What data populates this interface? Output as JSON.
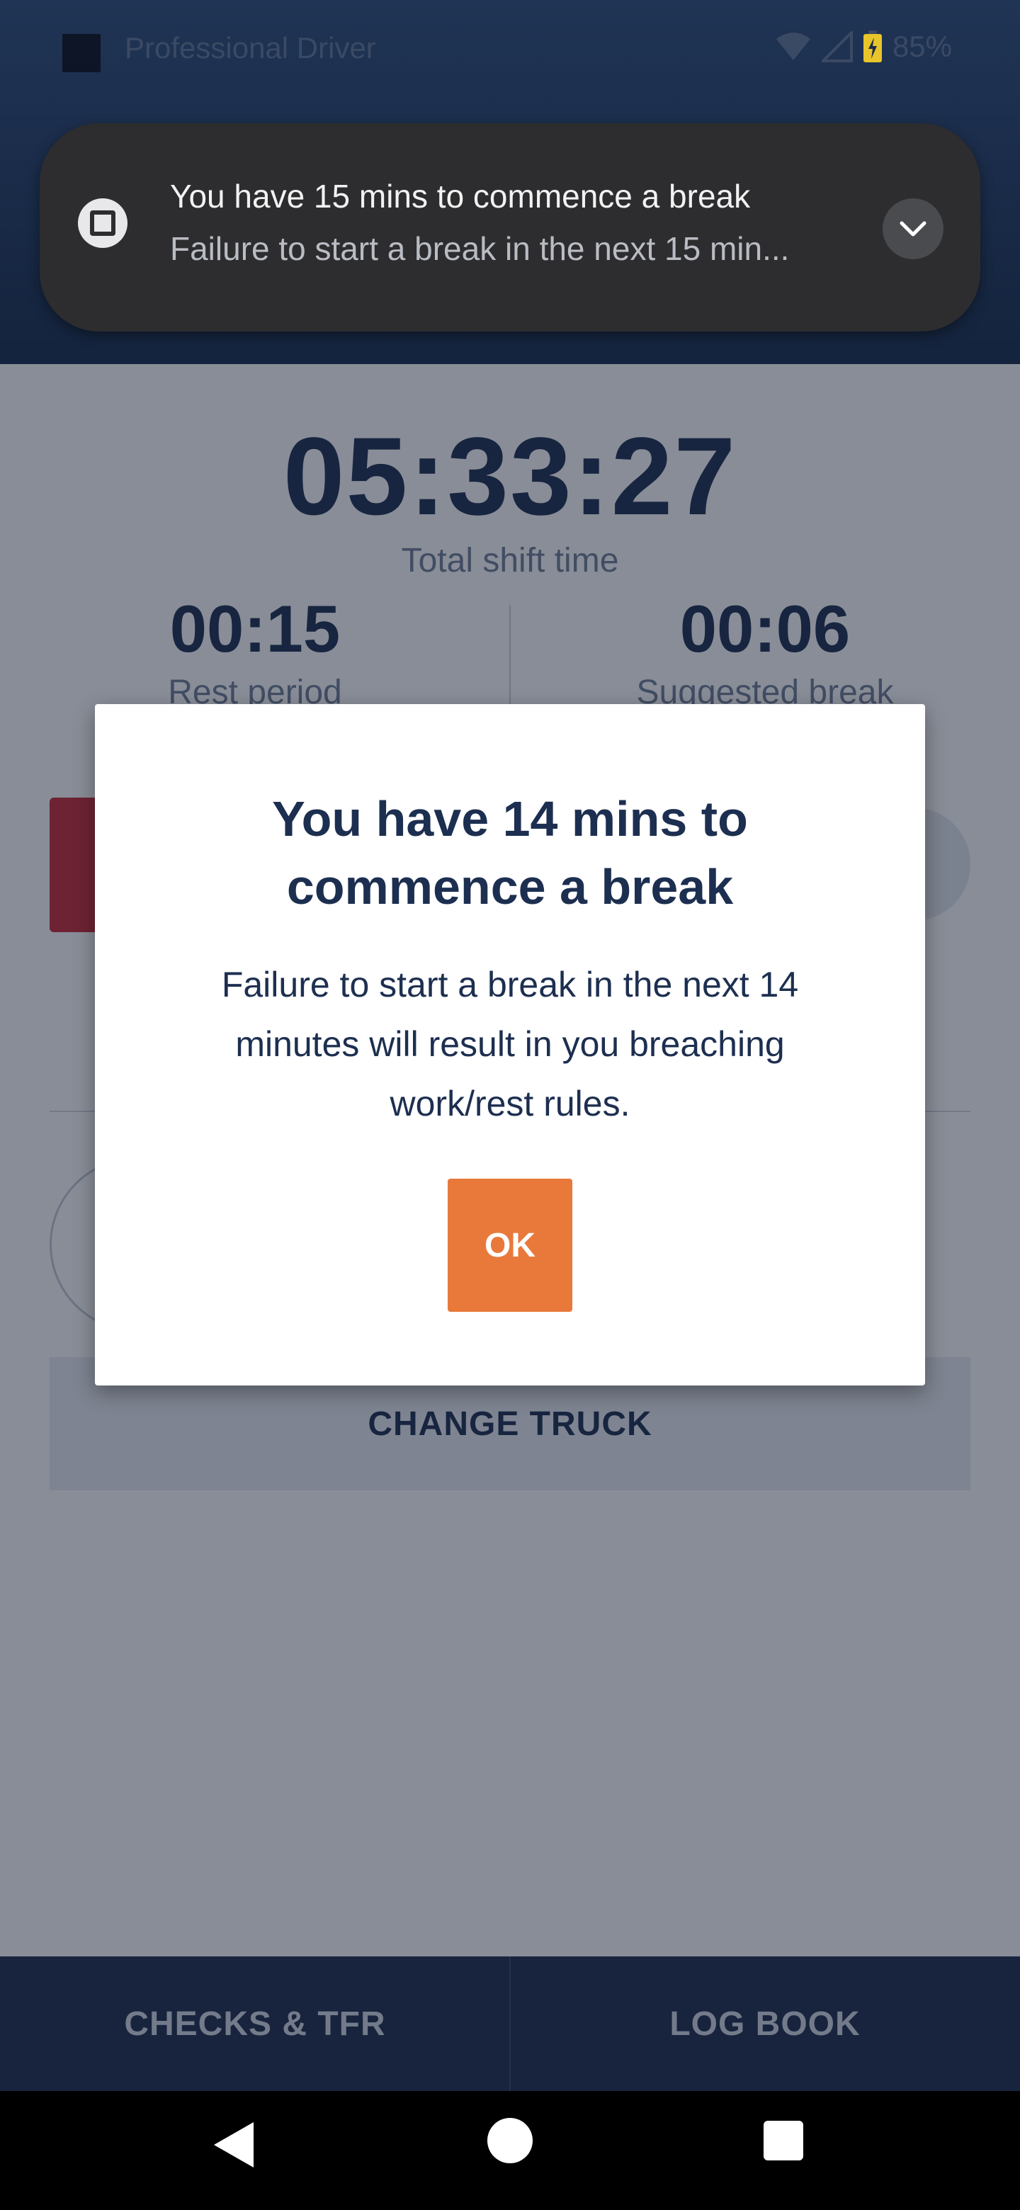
{
  "status_bar": {
    "app_name": "Professional Driver",
    "battery": "85%"
  },
  "notification": {
    "title": "You have 15 mins to commence a break",
    "text": "Failure to start a break in the next 15 min..."
  },
  "shift": {
    "total_time": "05:33:27",
    "total_label": "Total shift time",
    "rest_value": "00:15",
    "rest_label": "Rest period",
    "suggested_value": "00:06",
    "suggested_label": "Suggested break"
  },
  "actions": {
    "change_truck": "CHANGE TRUCK"
  },
  "bottom_nav": {
    "checks": "CHECKS & TFR",
    "logbook": "LOG BOOK"
  },
  "dialog": {
    "title": "You have 14 mins to commence a break",
    "body": "Failure to start a break in the next 14 minutes will result in you breaching work/rest rules.",
    "ok": "OK"
  },
  "colors": {
    "header": "#1c2c4a",
    "accent_orange": "#e8793b",
    "danger_red": "#c62a37",
    "text_navy": "#1d2f50"
  },
  "icons": {
    "status_left": "app-square-icon",
    "wifi": "wifi-icon",
    "signal": "cell-signal-icon",
    "battery": "battery-charging-icon",
    "notif": "app-notification-icon",
    "expand": "chevron-down-icon"
  }
}
